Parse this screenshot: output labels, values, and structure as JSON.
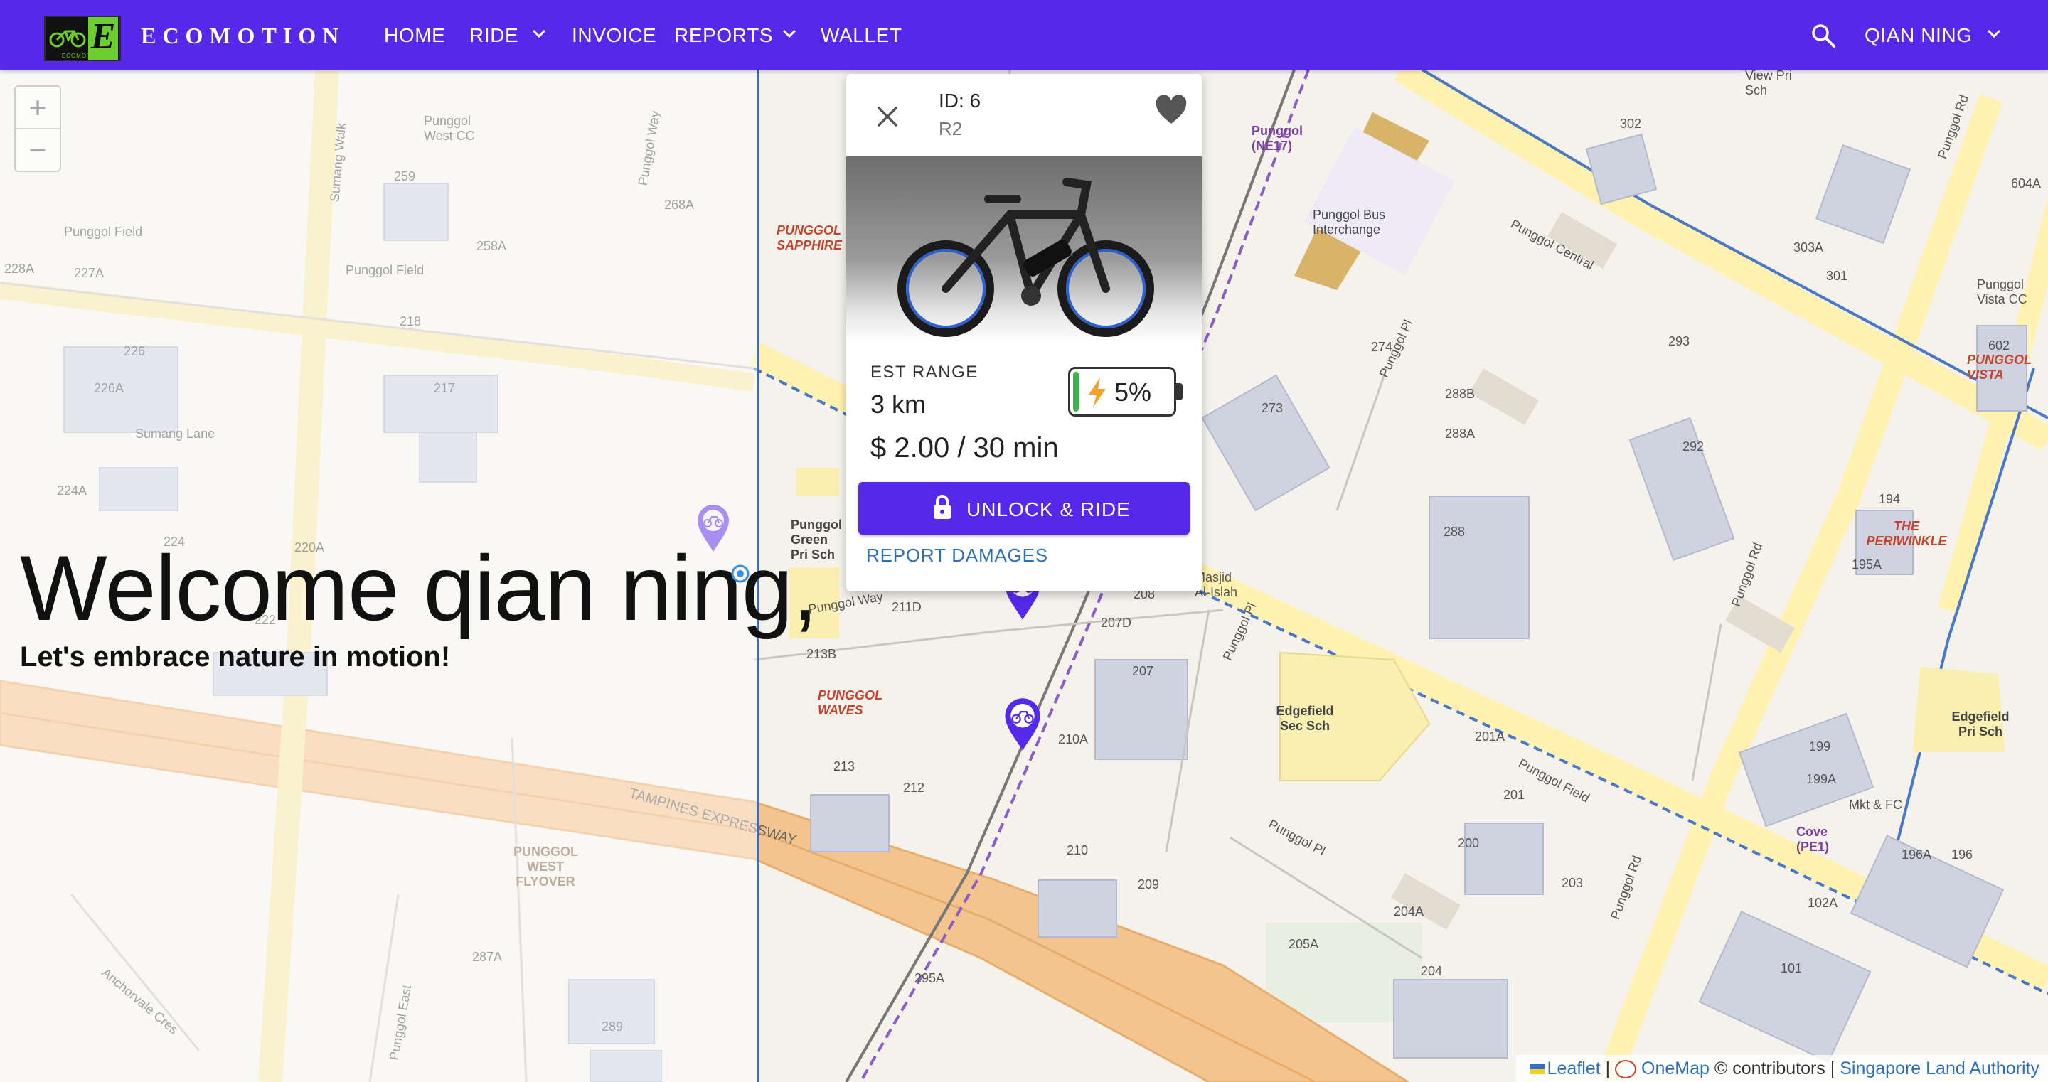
{
  "navbar": {
    "brand": "ECOMOTION",
    "logo_caption": "ECOMOTION",
    "logo_letter": "E",
    "items": [
      {
        "label": "HOME"
      },
      {
        "label": "RIDE"
      },
      {
        "label": "INVOICE"
      },
      {
        "label": "REPORTS"
      },
      {
        "label": "WALLET"
      }
    ],
    "user": "QIAN NING",
    "accent": "#5528ea"
  },
  "map": {
    "zoom_in": "+",
    "zoom_out": "−",
    "labels": {
      "punggol_field": "Punggol Field",
      "punggol_field_2": "Punggol Field",
      "punggol_field_3": "Punggol Field",
      "sumang_walk": "Sumang Walk",
      "sumang_lane": "Sumang Lane",
      "punggol_way": "Punggol Way",
      "punggol_way_2": "Punggol Way",
      "tampines_expressway": "TAMPINES EXPRESSWAY",
      "punggol_west_flyover": "PUNGGOL WEST FLYOVER",
      "anchorvale_cres": "Anchorvale Cres",
      "punggol_east": "Punggol East",
      "punggol_sapphire": "PUNGGOL SAPPHIRE",
      "punggol_waves": "PUNGGOL WAVES",
      "punggol_green": "Punggol Green Pri Sch",
      "punggol_ne17": "Punggol (NE17)",
      "punggol_bus": "Punggol Bus Interchange",
      "punggol_central": "Punggol Central",
      "punggol_pl": "Punggol Pl",
      "punggol_pl_2": "Punggol Pl",
      "punggol_pl_3": "Punggol Pl",
      "punggol_rd": "Punggol Rd",
      "punggol_rd_2": "Punggol Rd",
      "punggol_rd_3": "Punggol Rd",
      "masjid": "Masjid Al-Islah",
      "edgefield_sec": "Edgefield Sec Sch",
      "edgefield_pri": "Edgefield Pri Sch",
      "the_periwinkle": "THE PERIWINKLE",
      "punggol_vista": "PUNGGOL VISTA",
      "punggol_vista_cc": "Punggol Vista CC",
      "cove": "Cove (PE1)",
      "mkt": "Mkt & FC",
      "view_pri": "View Pri Sch",
      "punggol_west_cc": "Punggol West CC",
      "blk_226": "226",
      "blk_218": "218",
      "blk_217": "217",
      "blk_222": "222",
      "blk_289": "289",
      "blk_273": "273",
      "blk_288": "288",
      "blk_292": "292",
      "blk_207": "207",
      "blk_213": "213",
      "blk_210": "210",
      "blk_204": "204",
      "blk_201": "201",
      "blk_194": "194",
      "blk_196": "196",
      "blk_101": "101",
      "blk_199": "199",
      "blk_302": "302",
      "blk_301": "301",
      "blk_602": "602",
      "blk_259": "259",
      "blk_224": "224",
      "blk_274": "274",
      "blk_293": "293",
      "blk_209": "209",
      "blk_200": "200",
      "blk_203": "203",
      "blk_208": "208",
      "blk_212": "212",
      "blk_205a": "205A",
      "blk_204a": "204A",
      "blk_295a": "295A",
      "blk_288a": "288A",
      "blk_220a": "220A",
      "blk_207d": "207D",
      "blk_211d": "211D",
      "blk_213b": "213B",
      "blk_210a": "210A",
      "blk_201a": "201A",
      "blk_102a": "102A",
      "blk_199a": "199A",
      "blk_196a": "196A",
      "blk_195a": "195A",
      "blk_303a": "303A",
      "blk_604a": "604A",
      "blk_268a": "268A",
      "blk_258a": "258A",
      "blk_226a": "226A",
      "blk_224a": "224A",
      "blk_227a": "227A",
      "blk_228a": "228A",
      "blk_287a": "287A",
      "blk_288b": "288B"
    }
  },
  "welcome": {
    "title": "Welcome qian ning,",
    "subtitle": "Let's embrace nature in motion!"
  },
  "bike_card": {
    "id_text": "ID: 6",
    "code": "R2",
    "range_label": "EST RANGE",
    "range_value": "3 km",
    "battery_pct": "5%",
    "battery_level": 0.05,
    "price": "$ 2.00 / 30 min",
    "unlock_label": "UNLOCK & RIDE",
    "report_label": "REPORT DAMAGES"
  },
  "attribution": {
    "leaflet": "Leaflet",
    "sep": "|",
    "onemap": "OneMap",
    "contrib": "© contributors |",
    "sla": "Singapore Land Authority"
  }
}
